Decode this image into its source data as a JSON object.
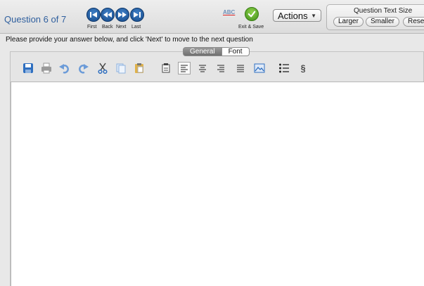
{
  "header": {
    "question_label": "Question 6 of 7",
    "nav": {
      "first_label": "First",
      "back_label": "Back",
      "next_label": "Next",
      "last_label": "Last"
    },
    "spell_label": "ABC",
    "exit_save_label": "Exit & Save",
    "actions_label": "Actions",
    "question_text_size": {
      "title": "Question Text Size",
      "larger_label": "Larger",
      "smaller_label": "Smaller",
      "reset_label": "Reset"
    }
  },
  "instruction": "Please provide your answer below, and click 'Next' to move to the next question",
  "editor": {
    "tabs": [
      {
        "label": "General",
        "active": true
      },
      {
        "label": "Font",
        "active": false
      }
    ],
    "toolbar_icons": [
      "save-icon",
      "print-icon",
      "undo-icon",
      "redo-icon",
      "cut-icon",
      "copy-icon",
      "paste-icon",
      "paste-special-icon",
      "align-left-icon",
      "align-center-icon",
      "align-right-icon",
      "justify-icon",
      "image-icon",
      "bulleted-list-icon",
      "section-symbol-icon"
    ],
    "section_symbol": "§",
    "content": ""
  },
  "colors": {
    "accent_blue": "#1f5b9e",
    "nav_button": "#154a8a",
    "exit_green": "#5cb82e",
    "toolbar_blue": "#2f6fc0"
  }
}
